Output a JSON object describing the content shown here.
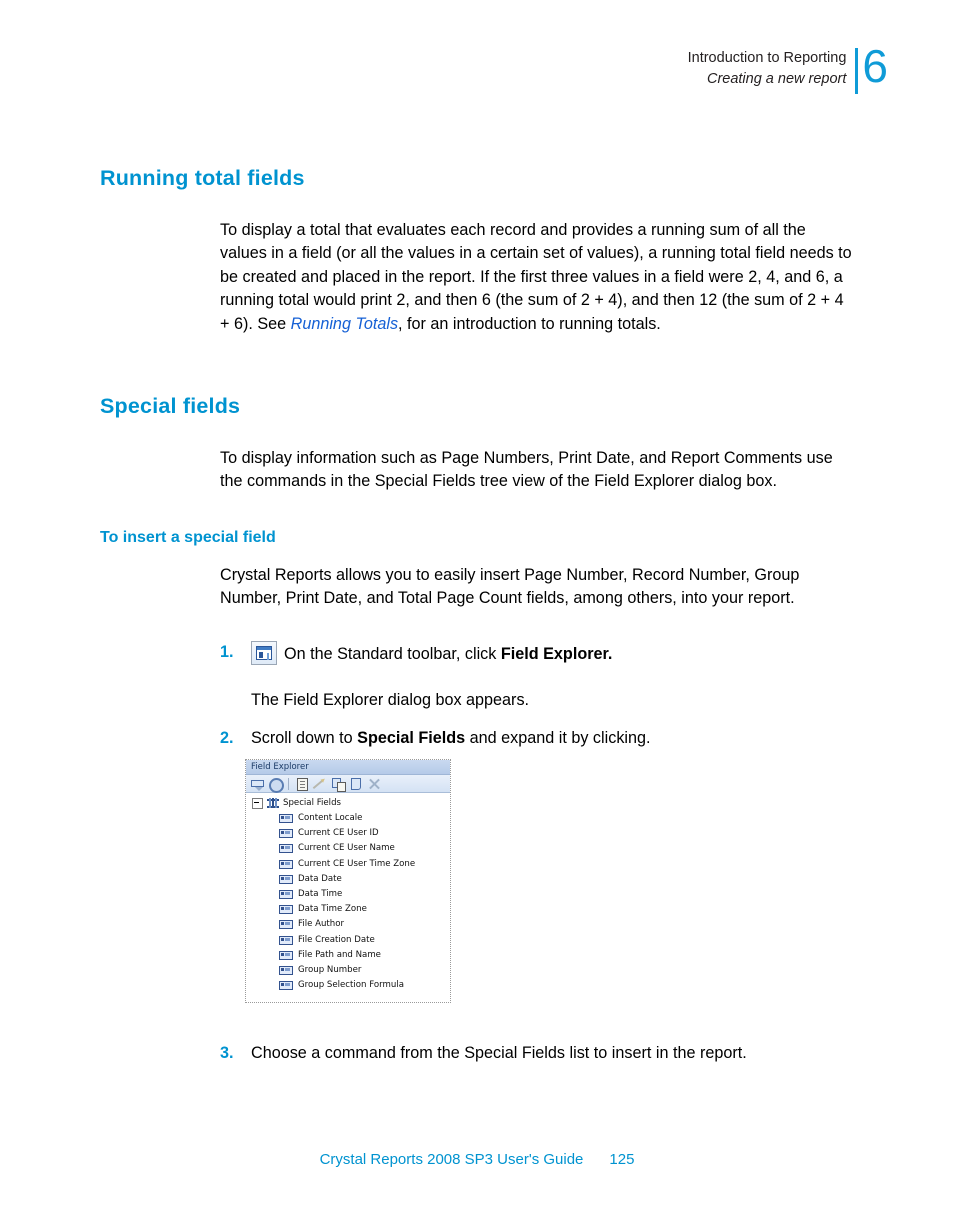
{
  "header": {
    "line1": "Introduction to Reporting",
    "line2": "Creating a new report",
    "chapter_number": "6",
    "accent_color": "#0f9bd7"
  },
  "sections": {
    "running_total": {
      "heading": "Running total fields",
      "paragraph_part1": "To display a total that evaluates each record and provides a running sum of all the values in a field (or all the values in a certain set of values), a running total field needs to be created and placed in the report. If the first three values in a field were 2, 4, and 6, a running total would print 2, and then 6 (the sum of 2 + 4), and then 12 (the sum of 2 + 4 + 6). See ",
      "link_text": "Running Totals",
      "paragraph_part2": ", for an introduction to running totals."
    },
    "special_fields": {
      "heading": "Special fields",
      "paragraph": "To display information such as Page Numbers, Print Date, and Report Comments use the commands in the Special Fields tree view of the Field Explorer dialog box."
    },
    "insert_special_field": {
      "heading": "To insert a special field",
      "intro": "Crystal Reports allows you to easily insert Page Number, Record Number, Group Number, Print Date, and Total Page Count fields, among others, into your report."
    }
  },
  "steps": [
    {
      "number": "1.",
      "icon": "field-explorer-toolbar-icon",
      "text_before": "On the Standard toolbar, click ",
      "text_bold": "Field Explorer.",
      "text_after": "",
      "continuation": "The Field Explorer dialog box appears."
    },
    {
      "number": "2.",
      "text_before": "Scroll down to ",
      "text_bold": "Special Fields",
      "text_after": " and expand it by clicking."
    },
    {
      "number": "3.",
      "text_before": "Choose a command from the Special Fields list to insert in the report.",
      "text_bold": "",
      "text_after": ""
    }
  ],
  "field_explorer": {
    "title": "Field Explorer",
    "toolbar_buttons": [
      "database-expert-icon",
      "find-field-icon",
      "new-formula-icon",
      "edit-icon",
      "rename-icon",
      "duplicate-icon",
      "delete-icon"
    ],
    "tree": {
      "root_label": "Special Fields",
      "root_icon": "special-fields-icon",
      "expander_state": "expanded",
      "items": [
        "Content Locale",
        "Current CE User ID",
        "Current CE User Name",
        "Current CE User Time Zone",
        "Data Date",
        "Data Time",
        "Data Time Zone",
        "File Author",
        "File Creation Date",
        "File Path and Name",
        "Group Number",
        "Group Selection Formula"
      ]
    }
  },
  "footer": {
    "title": "Crystal Reports 2008 SP3 User's Guide",
    "page_number": "125"
  }
}
